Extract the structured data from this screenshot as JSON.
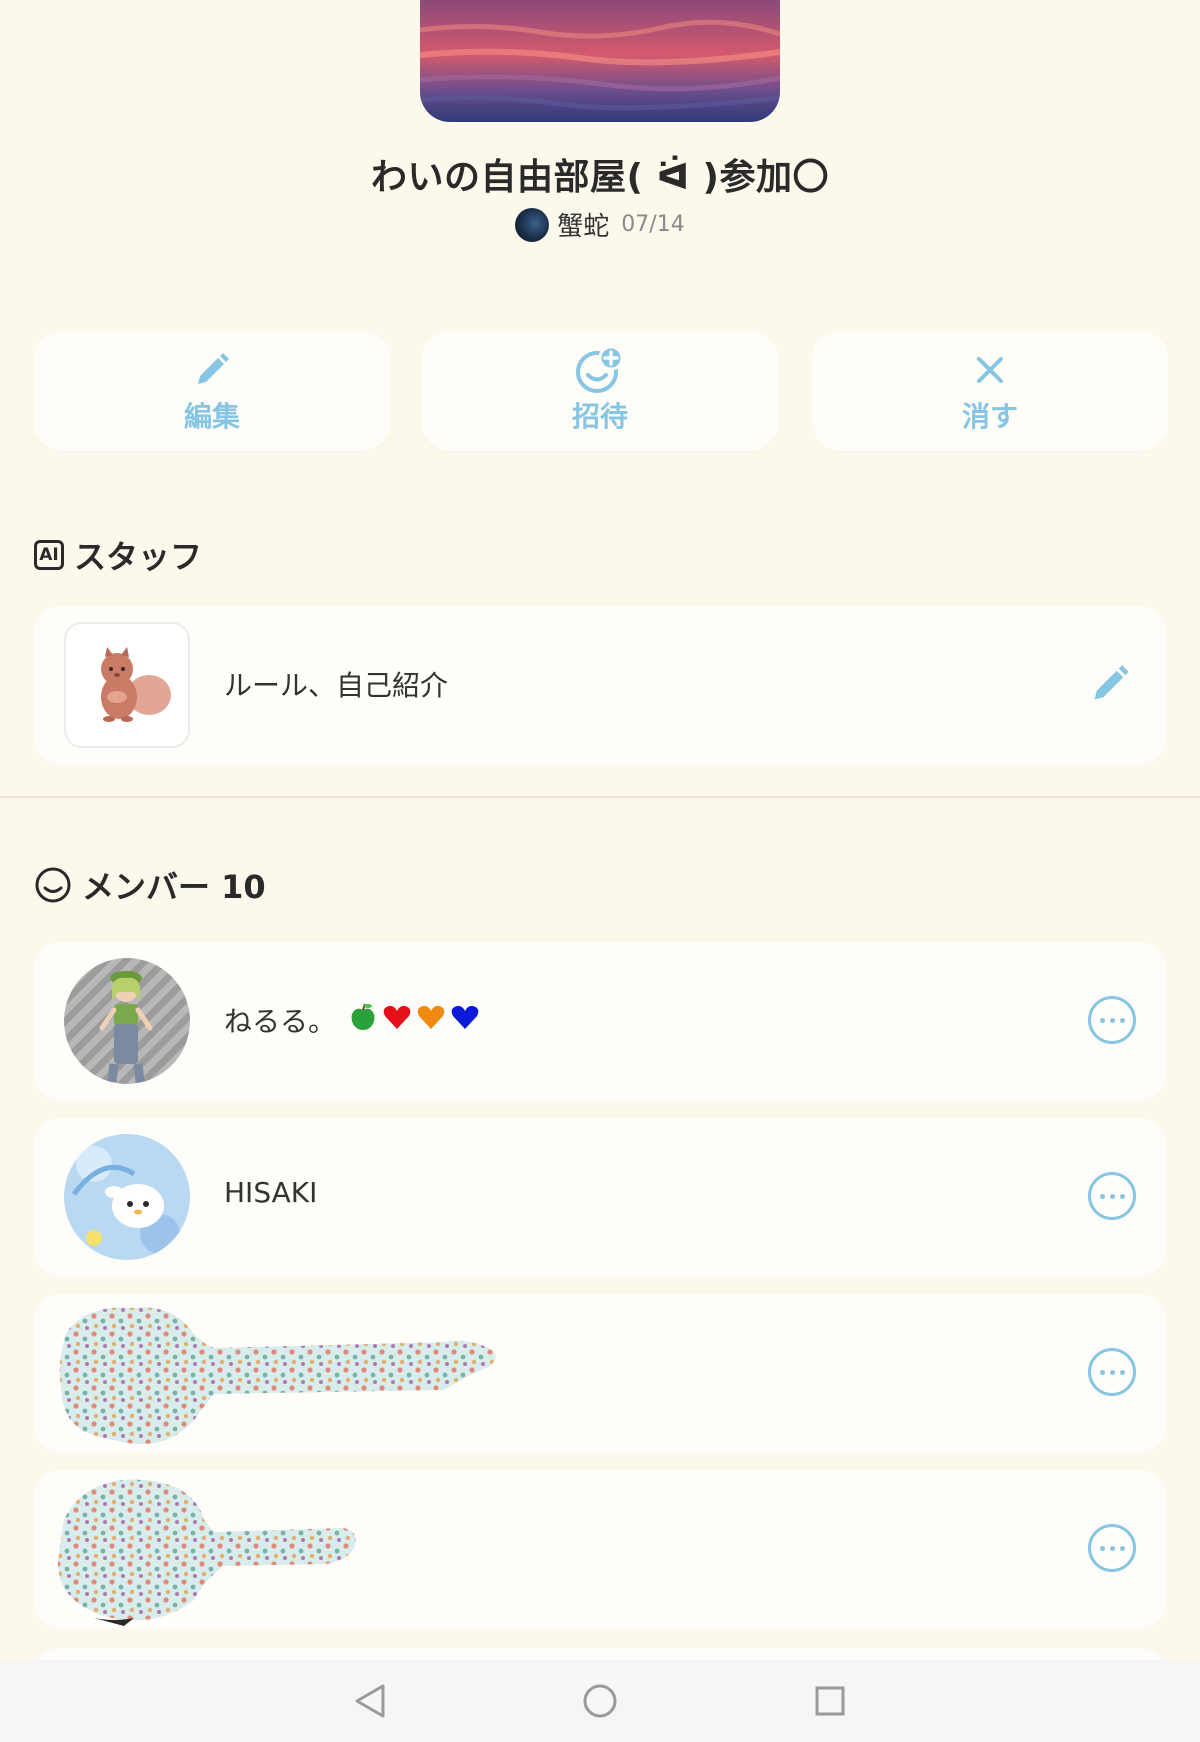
{
  "room": {
    "title": "わいの自由部屋( ᐛ )参加〇",
    "owner_name": "蟹蛇",
    "date": "07/14"
  },
  "actions": [
    {
      "label": "編集",
      "icon": "pencil-icon"
    },
    {
      "label": "招待",
      "icon": "invite-face-plus-icon"
    },
    {
      "label": "消す",
      "icon": "close-icon"
    }
  ],
  "staff": {
    "heading": "スタッフ",
    "badge": "AI",
    "item_label": "ルール、自己紹介",
    "thumb_icon": "squirrel-illustration"
  },
  "members": {
    "heading": "メンバー 10",
    "items": [
      {
        "name": "ねるる。",
        "emojis": [
          "🍏",
          "❤",
          "🧡",
          "💙"
        ]
      },
      {
        "name": "HISAKI"
      },
      {
        "name": ""
      },
      {
        "name": ""
      }
    ]
  },
  "colors": {
    "background": "#fdf8ec",
    "card": "#fffdf9",
    "accent": "#86c5e4",
    "text": "#2a2a2a"
  },
  "navbar": {
    "icons": [
      "back-triangle-icon",
      "home-circle-icon",
      "recents-square-icon"
    ]
  }
}
